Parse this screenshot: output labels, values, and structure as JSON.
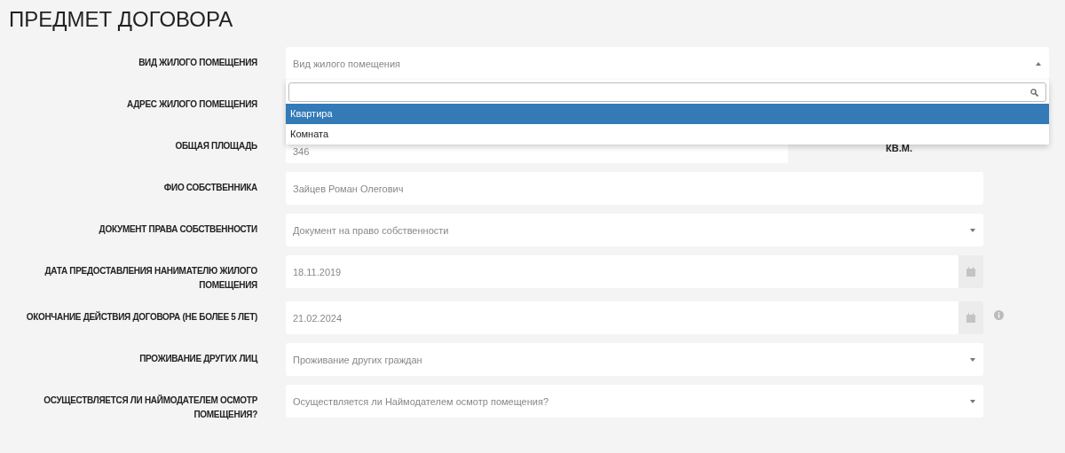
{
  "title": "ПРЕДМЕТ ДОГОВОРА",
  "fields": [
    {
      "kind": "select",
      "label": "ВИД ЖИЛОГО ПОМЕЩЕНИЯ",
      "placeholder": "Вид жилого помещения",
      "open": true,
      "options": [
        {
          "label": "Квартира",
          "selected": true
        },
        {
          "label": "Комната",
          "selected": false
        }
      ]
    },
    {
      "kind": "text",
      "label": "АДРЕС ЖИЛОГО ПОМЕЩЕНИЯ"
    },
    {
      "kind": "area",
      "label": "ОБЩАЯ ПЛОЩАДЬ",
      "value": "346",
      "unit": "КВ.М."
    },
    {
      "kind": "text",
      "label": "ФИО СОБСТВЕННИКА",
      "value": "Зайцев Роман Олегович"
    },
    {
      "kind": "select",
      "label": "ДОКУМЕНТ ПРАВА СОБСТВЕННОСТИ",
      "placeholder": "Документ на право собственности",
      "open": false
    },
    {
      "kind": "date",
      "label": "ДАТА ПРЕДОСТАВЛЕНИЯ НАНИМАТЕЛЮ ЖИЛОГО ПОМЕЩЕНИЯ",
      "value": "18.11.2019",
      "info": false
    },
    {
      "kind": "date",
      "label": "ОКОНЧАНИЕ ДЕЙСТВИЯ ДОГОВОРА (НЕ БОЛЕЕ 5 ЛЕТ)",
      "value": "21.02.2024",
      "info": true
    },
    {
      "kind": "select",
      "label": "ПРОЖИВАНИЕ ДРУГИХ ЛИЦ",
      "placeholder": "Проживание других граждан",
      "open": false
    },
    {
      "kind": "select",
      "label": "ОСУЩЕСТВЛЯЕТСЯ ЛИ НАЙМОДАТЕЛЕМ ОСМОТР ПОМЕЩЕНИЯ?",
      "placeholder": "Осуществляется ли Наймодателем осмотр помещения?",
      "open": false
    }
  ]
}
